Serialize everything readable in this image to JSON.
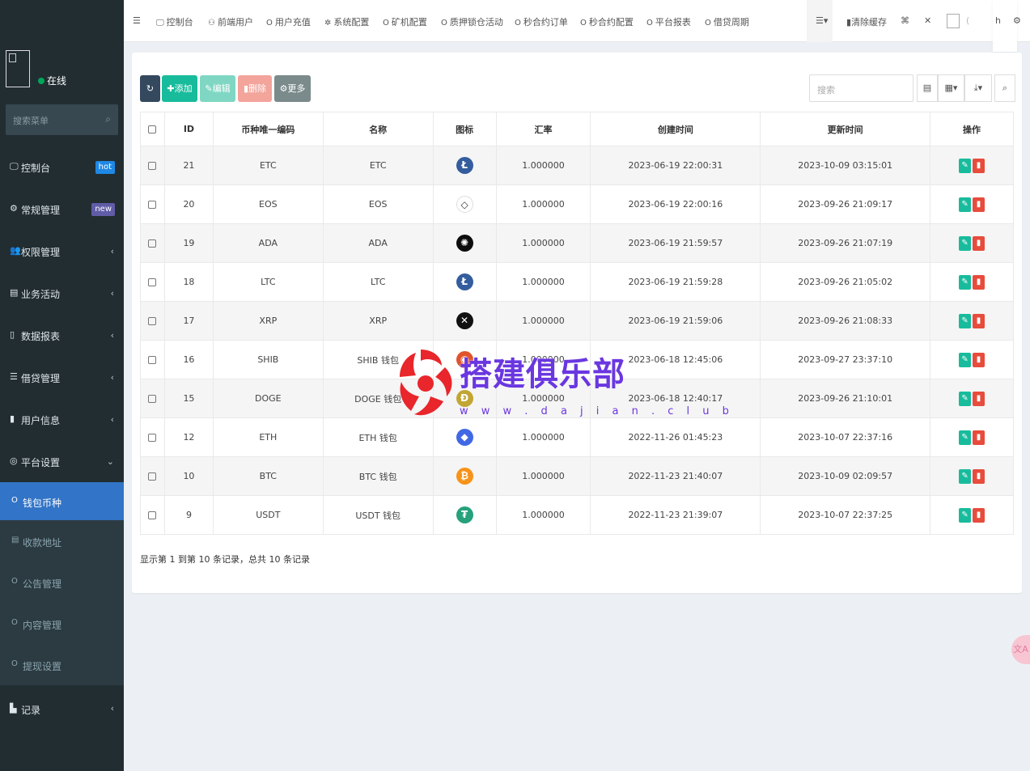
{
  "sidebar": {
    "status": "在线",
    "search_placeholder": "搜索菜单",
    "items": [
      {
        "icon": "dashboard-icon",
        "glyph": "🖵",
        "label": "控制台",
        "badge": "hot"
      },
      {
        "icon": "cogs-icon",
        "glyph": "⚙",
        "label": "常规管理",
        "badge": "new"
      },
      {
        "icon": "group-icon",
        "glyph": "👥",
        "label": "权限管理",
        "arrow": "‹"
      },
      {
        "icon": "list-alt-icon",
        "glyph": "▤",
        "label": "业务活动",
        "arrow": "‹"
      },
      {
        "icon": "file-icon",
        "glyph": "▯",
        "label": "数据报表",
        "arrow": "‹"
      },
      {
        "icon": "list-icon",
        "glyph": "☰",
        "label": "借贷管理",
        "arrow": "‹"
      },
      {
        "icon": "user-card-icon",
        "glyph": "▮",
        "label": "用户信息",
        "arrow": "‹"
      },
      {
        "icon": "settings-icon",
        "glyph": "◎",
        "label": "平台设置",
        "arrow": "⌄"
      }
    ],
    "submenu": [
      {
        "icon": "circle-icon",
        "glyph": "O",
        "label": "钱包币种",
        "active": true
      },
      {
        "icon": "list-alt-icon",
        "glyph": "▤",
        "label": "收款地址"
      },
      {
        "icon": "circle-icon",
        "glyph": "O",
        "label": "公告管理"
      },
      {
        "icon": "circle-icon",
        "glyph": "O",
        "label": "内容管理"
      },
      {
        "icon": "circle-icon",
        "glyph": "O",
        "label": "提现设置"
      }
    ],
    "last": {
      "icon": "area-chart-icon",
      "glyph": "▙",
      "label": "记录",
      "arrow": "‹"
    }
  },
  "topnav": {
    "menu_toggle": "☰",
    "items": [
      {
        "icon": "dashboard-icon",
        "glyph": "🖵",
        "label": "控制台"
      },
      {
        "icon": "user-icon",
        "glyph": "⚇",
        "label": "前端用户"
      },
      {
        "icon": "circle-icon",
        "glyph": "O",
        "label": "用户充值"
      },
      {
        "icon": "gear-icon",
        "glyph": "✲",
        "label": "系统配置"
      },
      {
        "icon": "circle-icon",
        "glyph": "O",
        "label": "矿机配置"
      },
      {
        "icon": "circle-icon",
        "glyph": "O",
        "label": "质押锁仓活动"
      },
      {
        "icon": "circle-icon",
        "glyph": "O",
        "label": "秒合约订单"
      },
      {
        "icon": "circle-icon",
        "glyph": "O",
        "label": "秒合约配置"
      },
      {
        "icon": "circle-icon",
        "glyph": "O",
        "label": "平台报表"
      },
      {
        "icon": "circle-icon",
        "glyph": "O",
        "label": "借贷周期"
      }
    ],
    "list_dropdown": "☰▾",
    "clear_cache": "清除缓存",
    "translate_glyph": "⌘",
    "fullscreen_glyph": "✕",
    "user_text": "(",
    "user_h": "h",
    "settings_glyph": "⚙"
  },
  "toolbar": {
    "refresh": "↻",
    "add": "✚添加",
    "edit": "✎编辑",
    "delete": "▮删除",
    "more": "⚙更多",
    "search_placeholder": "搜索",
    "tools": [
      "▤",
      "▦▾",
      "⤓▾",
      "⌕"
    ]
  },
  "table": {
    "headers": [
      "ID",
      "币种唯一编码",
      "名称",
      "图标",
      "汇率",
      "创建时间",
      "更新时间",
      "操作"
    ],
    "rows": [
      {
        "id": "21",
        "code": "ETC",
        "name": "ETC",
        "icon_glyph": "Ł",
        "icon_color": "#345d9d",
        "rate": "1.000000",
        "created": "2023-06-19 22:00:31",
        "updated": "2023-10-09 03:15:01"
      },
      {
        "id": "20",
        "code": "EOS",
        "name": "EOS",
        "icon_glyph": "◇",
        "icon_color": "#ffffff",
        "rate": "1.000000",
        "created": "2023-06-19 22:00:16",
        "updated": "2023-09-26 21:09:17"
      },
      {
        "id": "19",
        "code": "ADA",
        "name": "ADA",
        "icon_glyph": "✺",
        "icon_color": "#0d0d0d",
        "rate": "1.000000",
        "created": "2023-06-19 21:59:57",
        "updated": "2023-09-26 21:07:19"
      },
      {
        "id": "18",
        "code": "LTC",
        "name": "LTC",
        "icon_glyph": "Ł",
        "icon_color": "#345d9d",
        "rate": "1.000000",
        "created": "2023-06-19 21:59:28",
        "updated": "2023-09-26 21:05:02"
      },
      {
        "id": "17",
        "code": "XRP",
        "name": "XRP",
        "icon_glyph": "✕",
        "icon_color": "#111111",
        "rate": "1.000000",
        "created": "2023-06-19 21:59:06",
        "updated": "2023-09-26 21:08:33"
      },
      {
        "id": "16",
        "code": "SHIB",
        "name": "SHIB 钱包",
        "icon_glyph": "◉",
        "icon_color": "#e0532b",
        "rate": "1.000000",
        "created": "2023-06-18 12:45:06",
        "updated": "2023-09-27 23:37:10"
      },
      {
        "id": "15",
        "code": "DOGE",
        "name": "DOGE 钱包",
        "icon_glyph": "Ð",
        "icon_color": "#c2a633",
        "rate": "1.000000",
        "created": "2023-06-18 12:40:17",
        "updated": "2023-09-26 21:10:01"
      },
      {
        "id": "12",
        "code": "ETH",
        "name": "ETH 钱包",
        "icon_glyph": "◆",
        "icon_color": "#4168e4",
        "rate": "1.000000",
        "created": "2022-11-26 01:45:23",
        "updated": "2023-10-07 22:37:16"
      },
      {
        "id": "10",
        "code": "BTC",
        "name": "BTC 钱包",
        "icon_glyph": "₿",
        "icon_color": "#f7931a",
        "rate": "1.000000",
        "created": "2022-11-23 21:40:07",
        "updated": "2023-10-09 02:09:57"
      },
      {
        "id": "9",
        "code": "USDT",
        "name": "USDT 钱包",
        "icon_glyph": "₮",
        "icon_color": "#26a17b",
        "rate": "1.000000",
        "created": "2022-11-23 21:39:07",
        "updated": "2023-10-07 22:37:25"
      }
    ],
    "edit_glyph": "✎",
    "delete_glyph": "▮"
  },
  "footer": {
    "info": "显示第 1 到第 10 条记录，总共 10 条记录"
  },
  "watermark": {
    "text": "搭建俱乐部",
    "url": "w w w . d a j i a n . c l u b"
  },
  "float_tool": {
    "glyph": "文A"
  }
}
